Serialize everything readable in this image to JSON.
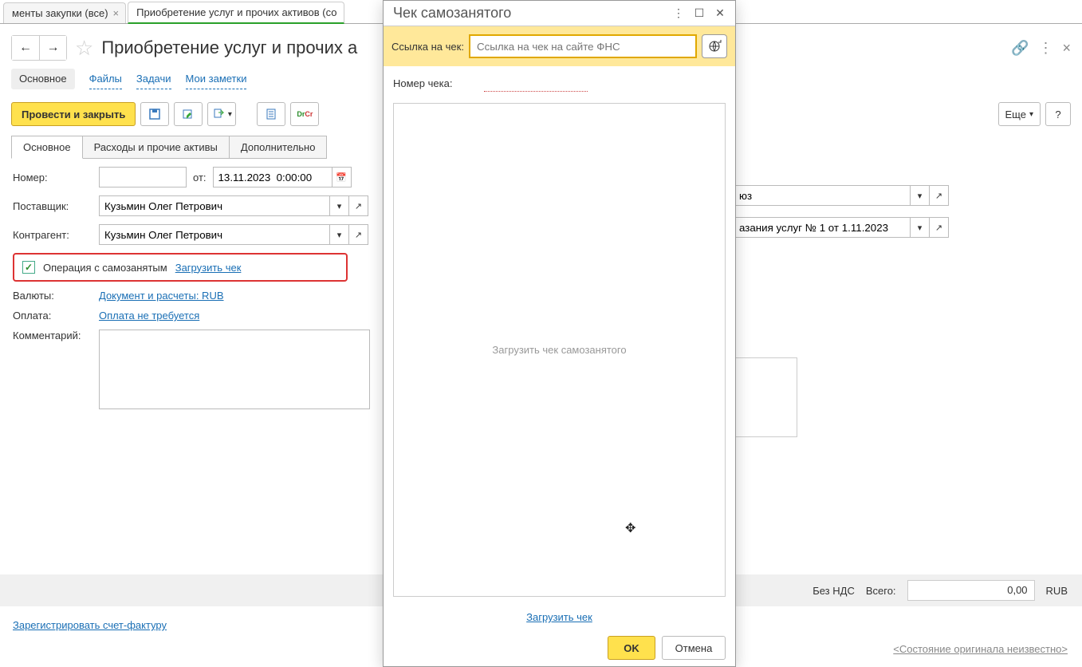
{
  "tabs": {
    "list": [
      {
        "label": "менты закупки (все)",
        "active": false
      },
      {
        "label": "Приобретение услуг и прочих активов (со",
        "active": true
      }
    ]
  },
  "header": {
    "title": "Приобретение услуг и прочих а"
  },
  "nav_links": {
    "main": "Основное",
    "files": "Файлы",
    "tasks": "Задачи",
    "notes": "Мои заметки"
  },
  "toolbar": {
    "post_close": "Провести и закрыть",
    "more": "Еще",
    "help": "?"
  },
  "inner_tabs": {
    "main": "Основное",
    "expenses": "Расходы и прочие активы",
    "extra": "Дополнительно"
  },
  "form": {
    "number_label": "Номер:",
    "from_label": "от:",
    "date_value": "13.11.2023  0:00:00",
    "supplier_label": "Поставщик:",
    "supplier_value": "Кузьмин Олег Петрович",
    "counterparty_label": "Контрагент:",
    "counterparty_value": "Кузьмин Олег Петрович",
    "self_employed_label": "Операция с самозанятым",
    "load_cheque": "Загрузить чек",
    "currency_label": "Валюты:",
    "currency_link": "Документ и расчеты: RUB",
    "payment_label": "Оплата:",
    "payment_link": "Оплата не требуется",
    "comment_label": "Комментарий:"
  },
  "right": {
    "org_value": "юз",
    "contract_value": "азания услуг № 1 от 1.11.2023"
  },
  "footer": {
    "no_vat": "Без НДС",
    "total_label": "Всего:",
    "total_value": "0,00",
    "currency": "RUB"
  },
  "bottom_links": {
    "register_invoice": "Зарегистрировать счет-фактуру",
    "original_status": "<Состояние оригинала неизвестно>"
  },
  "modal": {
    "title": "Чек самозанятого",
    "link_label": "Ссылка на чек:",
    "link_placeholder": "Ссылка на чек на сайте ФНС",
    "cheque_no_label": "Номер чека:",
    "dropzone_text": "Загрузить чек самозанятого",
    "load_link": "Загрузить чек",
    "ok": "OK",
    "cancel": "Отмена"
  }
}
